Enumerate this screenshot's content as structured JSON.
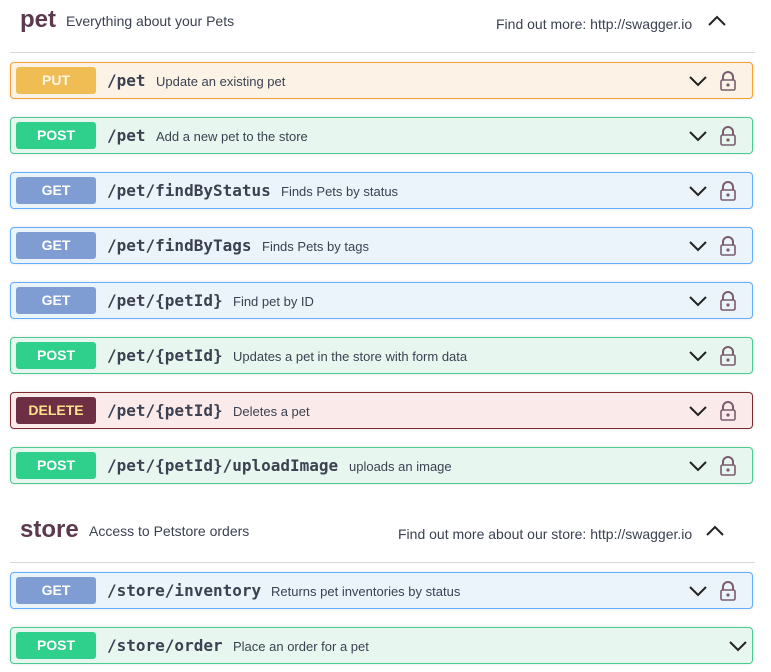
{
  "tags": [
    {
      "name": "pet",
      "description": "Everything about your Pets",
      "link_prefix": "Find out more:",
      "link_url": "http://swagger.io",
      "operations": [
        {
          "method": "PUT",
          "path": "/pet",
          "summary": "Update an existing pet"
        },
        {
          "method": "POST",
          "path": "/pet",
          "summary": "Add a new pet to the store"
        },
        {
          "method": "GET",
          "path": "/pet/findByStatus",
          "summary": "Finds Pets by status"
        },
        {
          "method": "GET",
          "path": "/pet/findByTags",
          "summary": "Finds Pets by tags"
        },
        {
          "method": "GET",
          "path": "/pet/{petId}",
          "summary": "Find pet by ID"
        },
        {
          "method": "POST",
          "path": "/pet/{petId}",
          "summary": "Updates a pet in the store with form data"
        },
        {
          "method": "DELETE",
          "path": "/pet/{petId}",
          "summary": "Deletes a pet"
        },
        {
          "method": "POST",
          "path": "/pet/{petId}/uploadImage",
          "summary": "uploads an image"
        }
      ]
    },
    {
      "name": "store",
      "description": "Access to Petstore orders",
      "link_prefix": "Find out more about our store:",
      "link_url": "http://swagger.io",
      "operations": [
        {
          "method": "GET",
          "path": "/store/inventory",
          "summary": "Returns pet inventories by status"
        },
        {
          "method": "POST",
          "path": "/store/order",
          "summary": "Place an order for a pet"
        }
      ]
    }
  ],
  "colors": {
    "put": "#fca130",
    "post": "#49cc90",
    "get": "#61affe",
    "delete": "#7a2c2c",
    "tag_name": "#5b3a4f"
  },
  "icons": {
    "expand": "chevron-down-icon",
    "collapse": "chevron-up-icon",
    "auth": "lock-icon"
  }
}
